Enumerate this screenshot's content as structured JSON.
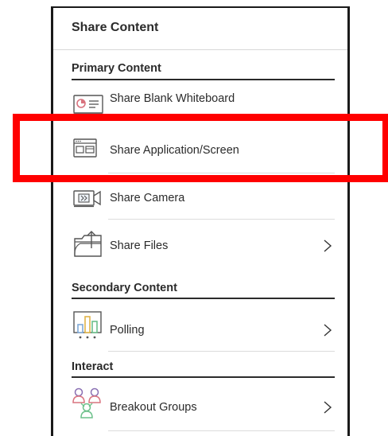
{
  "panel": {
    "title": "Share Content"
  },
  "sections": {
    "primary": {
      "title": "Primary Content",
      "items": [
        {
          "label": "Share Blank Whiteboard",
          "icon": "whiteboard-icon",
          "has_chevron": false
        },
        {
          "label": "Share Application/Screen",
          "icon": "application-screen-icon",
          "has_chevron": false
        },
        {
          "label": "Share Camera",
          "icon": "camera-icon",
          "has_chevron": false
        },
        {
          "label": "Share Files",
          "icon": "files-icon",
          "has_chevron": true
        }
      ]
    },
    "secondary": {
      "title": "Secondary Content",
      "items": [
        {
          "label": "Polling",
          "icon": "polling-icon",
          "has_chevron": true
        }
      ]
    },
    "interact": {
      "title": "Interact",
      "items": [
        {
          "label": "Breakout Groups",
          "icon": "breakout-groups-icon",
          "has_chevron": true
        }
      ]
    }
  },
  "highlight": {
    "color": "#ff0000",
    "target": "Share Application/Screen"
  },
  "colors": {
    "text": "#2b2b2b",
    "border": "#1a1a1a",
    "divider": "#dcdcdc",
    "icon_pink": "#d9737f",
    "icon_green": "#6cc08a",
    "icon_gold": "#e0b44a",
    "icon_purple": "#8a6fb3",
    "icon_blue": "#7fa8d6"
  }
}
